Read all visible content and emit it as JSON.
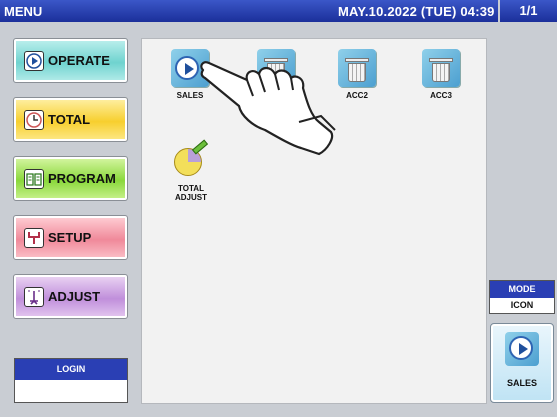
{
  "header": {
    "title": "MENU",
    "datetime": "MAY.10.2022 (TUE)  04:39",
    "page": "1/1"
  },
  "sidebar": {
    "items": [
      {
        "label": "OPERATE",
        "icon": "play-icon"
      },
      {
        "label": "TOTAL",
        "icon": "clock-icon"
      },
      {
        "label": "PROGRAM",
        "icon": "book-icon"
      },
      {
        "label": "SETUP",
        "icon": "wrench-icon"
      },
      {
        "label": "ADJUST",
        "icon": "adjust-icon"
      }
    ]
  },
  "login": {
    "label": "LOGIN",
    "value": ""
  },
  "main": {
    "icons": [
      {
        "label": "SALES",
        "icon": "play-icon"
      },
      {
        "label": "",
        "icon": "trash-icon"
      },
      {
        "label": "ACC2",
        "icon": "trash-icon"
      },
      {
        "label": "ACC3",
        "icon": "trash-icon"
      },
      {
        "label": "TOTAL\nADJUST",
        "icon": "pie-chart-icon"
      }
    ]
  },
  "mode": {
    "label": "MODE",
    "value": "ICON"
  },
  "quick_button": {
    "label": "SALES",
    "icon": "play-icon"
  },
  "colors": {
    "header_blue": "#1b2f9a",
    "label_blue": "#2a3fb4"
  }
}
